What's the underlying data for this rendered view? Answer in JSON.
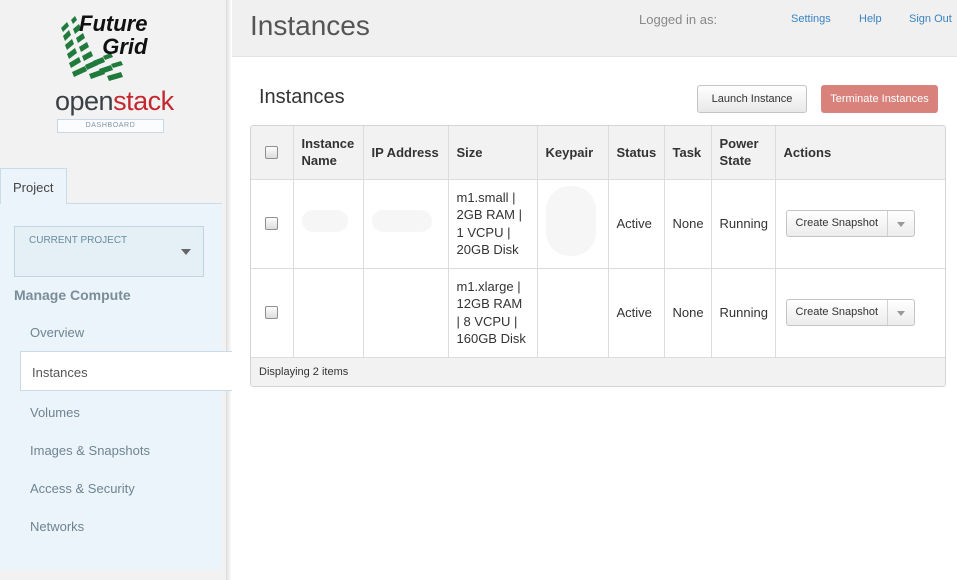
{
  "logo": {
    "line1": "Future",
    "line2": "Grid",
    "brand_a": "open",
    "brand_b": "stack",
    "dashboard_label": "DASHBOARD"
  },
  "sidebar": {
    "tab": "Project",
    "current_project_label": "CURRENT PROJECT",
    "section_title": "Manage Compute",
    "items": [
      "Overview",
      "Instances",
      "Volumes",
      "Images & Snapshots",
      "Access & Security",
      "Networks"
    ],
    "active_item": "Instances"
  },
  "header": {
    "title": "Instances",
    "logged_in": "Logged in as:",
    "links": [
      "Settings",
      "Help",
      "Sign Out"
    ]
  },
  "main": {
    "title": "Instances",
    "launch_label": "Launch Instance",
    "terminate_label": "Terminate Instances",
    "columns": [
      "Instance Name",
      "IP Address",
      "Size",
      "Keypair",
      "Status",
      "Task",
      "Power State",
      "Actions"
    ],
    "rows": [
      {
        "size": "m1.small | 2GB RAM | 1 VCPU | 20GB Disk",
        "status": "Active",
        "task": "None",
        "power": "Running",
        "action": "Create Snapshot"
      },
      {
        "size": "m1.xlarge | 12GB RAM | 8 VCPU | 160GB Disk",
        "status": "Active",
        "task": "None",
        "power": "Running",
        "action": "Create Snapshot"
      }
    ],
    "footer": "Displaying 2 items"
  },
  "colors": {
    "accent_link": "#3a83c4",
    "terminate": "#d9827c",
    "brand_red": "#c4282f",
    "sidebar_bg": "#eaf4fa"
  }
}
